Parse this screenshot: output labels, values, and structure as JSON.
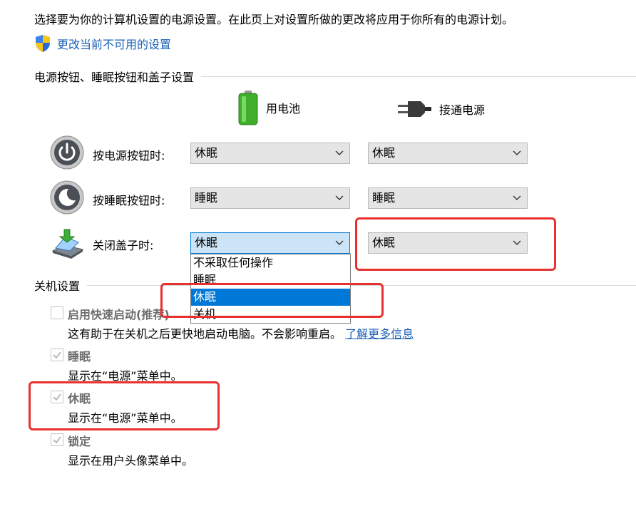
{
  "intro": "选择要为你的计算机设置的电源设置。在此页上对设置所做的更改将应用于你所有的电源计划。",
  "change_link": "更改当前不可用的设置",
  "power_section": {
    "title": "电源按钮、睡眠按钮和盖子设置",
    "col_battery": "用电池",
    "col_plugged": "接通电源",
    "rows": [
      {
        "label": "按电源按钮时:",
        "battery": "休眠",
        "plugged": "休眠",
        "icon": "power-button-icon"
      },
      {
        "label": "按睡眠按钮时:",
        "battery": "睡眠",
        "plugged": "睡眠",
        "icon": "sleep-button-icon"
      },
      {
        "label": "关闭盖子时:",
        "battery": "休眠",
        "plugged": "休眠",
        "icon": "laptop-lid-icon"
      }
    ],
    "lid_dropdown_options": [
      "不采取任何操作",
      "睡眠",
      "休眠",
      "关机"
    ],
    "lid_dropdown_selected": "休眠"
  },
  "shutdown_section": {
    "title": "关机设置",
    "items": [
      {
        "title": "启用快速启动(推荐)",
        "desc": "这有助于在关机之后更快地启动电脑。不会影响重启。",
        "link": "了解更多信息",
        "checked": false
      },
      {
        "title": "睡眠",
        "desc": "显示在“电源”菜单中。",
        "checked": true
      },
      {
        "title": "休眠",
        "desc": "显示在“电源”菜单中。",
        "checked": true
      },
      {
        "title": "锁定",
        "desc": "显示在用户头像菜单中。",
        "checked": true
      }
    ]
  },
  "colors": {
    "link": "#1a5fb4",
    "highlight_box": "#e8312e",
    "dropdown_selected": "#0078d7",
    "select_bg": "#e5e5e5"
  }
}
